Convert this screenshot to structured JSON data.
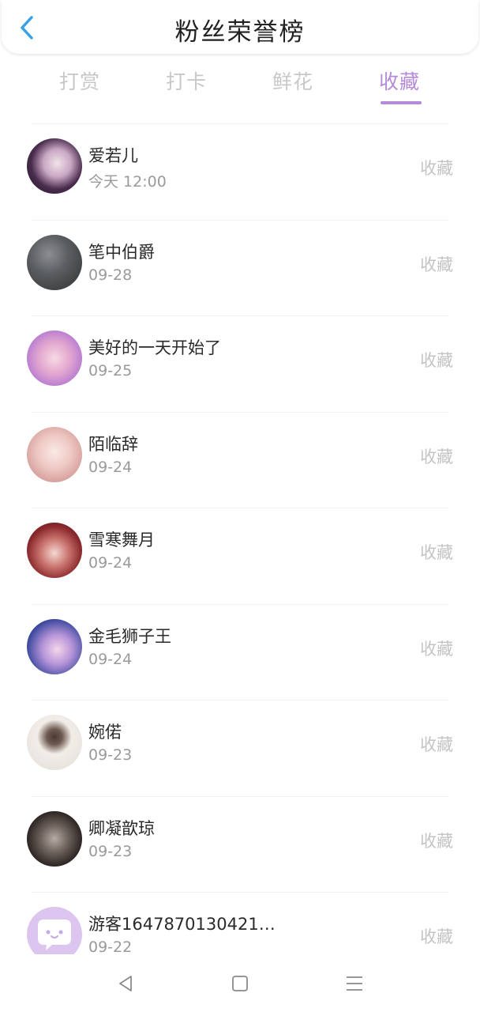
{
  "header": {
    "title": "粉丝荣誉榜",
    "back_icon": "chevron-left-icon",
    "accent": "#3aa0e6"
  },
  "tabs": [
    {
      "label": "打赏",
      "active": false
    },
    {
      "label": "打卡",
      "active": false
    },
    {
      "label": "鲜花",
      "active": false
    },
    {
      "label": "收藏",
      "active": true
    }
  ],
  "colors": {
    "accent": "#b58ad8",
    "inactive_tab": "#c8c8c8",
    "secondary_text": "#9a9a9a"
  },
  "items": [
    {
      "name": "爱若儿",
      "date": "今天 12:00",
      "action": "收藏",
      "avatar": "avatar-photo"
    },
    {
      "name": "笔中伯爵",
      "date": "09-28",
      "action": "收藏",
      "avatar": "avatar-photo"
    },
    {
      "name": "美好的一天开始了",
      "date": "09-25",
      "action": "收藏",
      "avatar": "avatar-photo"
    },
    {
      "name": "陌临辞",
      "date": "09-24",
      "action": "收藏",
      "avatar": "avatar-photo"
    },
    {
      "name": "雪寒舞月",
      "date": "09-24",
      "action": "收藏",
      "avatar": "avatar-photo"
    },
    {
      "name": "金毛狮子王",
      "date": "09-24",
      "action": "收藏",
      "avatar": "avatar-photo"
    },
    {
      "name": "婉偌",
      "date": "09-23",
      "action": "收藏",
      "avatar": "avatar-photo"
    },
    {
      "name": "卿凝歆琼",
      "date": "09-23",
      "action": "收藏",
      "avatar": "avatar-photo"
    },
    {
      "name": "游客1647870130421…",
      "date": "09-22",
      "action": "收藏",
      "avatar": "default-chat-avatar-icon"
    }
  ],
  "navbar": {
    "back": "triangle-back-icon",
    "home": "square-home-icon",
    "menu": "hamburger-menu-icon"
  }
}
